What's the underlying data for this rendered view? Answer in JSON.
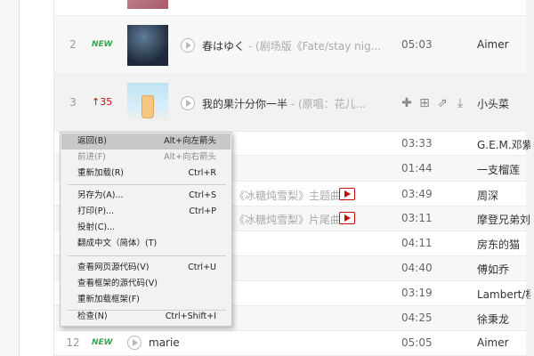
{
  "rows": [
    {
      "rank": "2",
      "trend": "NEW",
      "title": "春はゆく",
      "subtitle": " - (剧场版《Fate/stay nig...",
      "duration": "05:03",
      "artist": "Aimer"
    },
    {
      "rank": "3",
      "trend": "↑35",
      "title": "我的果汁分你一半",
      "subtitle": " - (原唱：花儿...",
      "duration": "",
      "artist": "小头菜"
    },
    {
      "duration": "03:33",
      "artist": "G.E.M.邓紫棋"
    },
    {
      "duration": "01:44",
      "artist": "一支榴莲"
    },
    {
      "title_partial": "《冰糖炖雪梨》主题曲)",
      "duration": "03:49",
      "artist": "周深"
    },
    {
      "title_partial": "《冰糖炖雪梨》片尾曲)",
      "duration": "03:11",
      "artist": "摩登兄弟刘宇宁"
    },
    {
      "duration": "04:11",
      "artist": "房东的猫"
    },
    {
      "duration": "04:40",
      "artist": "傅如乔"
    },
    {
      "duration": "03:19",
      "artist": "Lambert/杨胖雨"
    },
    {
      "duration": "04:25",
      "artist": "徐秉龙"
    },
    {
      "rank": "12",
      "trend": "NEW",
      "title": "marie",
      "duration": "05:05",
      "artist": "Aimer"
    }
  ],
  "context_menu": {
    "items": [
      {
        "label": "返回(B)",
        "shortcut": "Alt+向左箭头"
      },
      {
        "label": "前进(F)",
        "shortcut": "Alt+向右箭头"
      },
      {
        "label": "重新加载(R)",
        "shortcut": "Ctrl+R"
      },
      {
        "label": "另存为(A)...",
        "shortcut": "Ctrl+S"
      },
      {
        "label": "打印(P)...",
        "shortcut": "Ctrl+P"
      },
      {
        "label": "投射(C)...",
        "shortcut": ""
      },
      {
        "label": "翻成中文（简体）(T)",
        "shortcut": ""
      },
      {
        "label": "查看网页源代码(V)",
        "shortcut": "Ctrl+U"
      },
      {
        "label": "查看框架的源代码(V)",
        "shortcut": ""
      },
      {
        "label": "重新加载框架(F)",
        "shortcut": ""
      },
      {
        "label": "检查(N)",
        "shortcut": "Ctrl+Shift+I"
      }
    ]
  },
  "colors": {
    "new": "#3aa34f",
    "up": "#c20c0c",
    "mv": "#c20c0c"
  }
}
